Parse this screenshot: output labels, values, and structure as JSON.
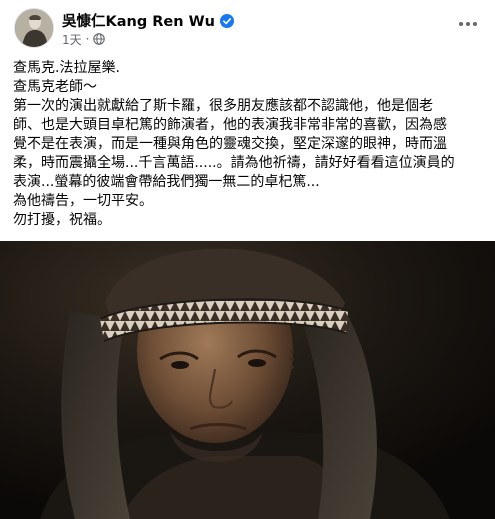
{
  "post": {
    "author": {
      "name": "吳慷仁Kang Ren Wu",
      "verified": true
    },
    "meta": {
      "timestamp": "1天",
      "separator": "·",
      "audience_icon": "globe-icon"
    },
    "more_icon": "more-options-icon",
    "text_lines": [
      "查馬克.法拉屋樂.",
      "查馬克老師～",
      "第一次的演出就獻給了斯卡羅，很多朋友應該都不認識他，他是個老",
      "師、也是大頭目卓杞篤的飾演者，他的表演我非常非常的喜歡，因為感",
      "覺不是在表演，而是一種與角色的靈魂交換，堅定深邃的眼神，時而溫",
      "柔，時而震攝全場...千言萬語.....。請為他祈禱，請好好看看這位演員的",
      "表演...螢幕的彼端會帶給我們獨一無二的卓杞篤...",
      "為他禱告，一切平安。",
      "勿打擾，祝福。"
    ],
    "photo": {
      "subject": "actor-portrait"
    }
  },
  "colors": {
    "verified_blue": "#1877f2",
    "secondary_text": "#65676b",
    "primary_text": "#050505"
  }
}
